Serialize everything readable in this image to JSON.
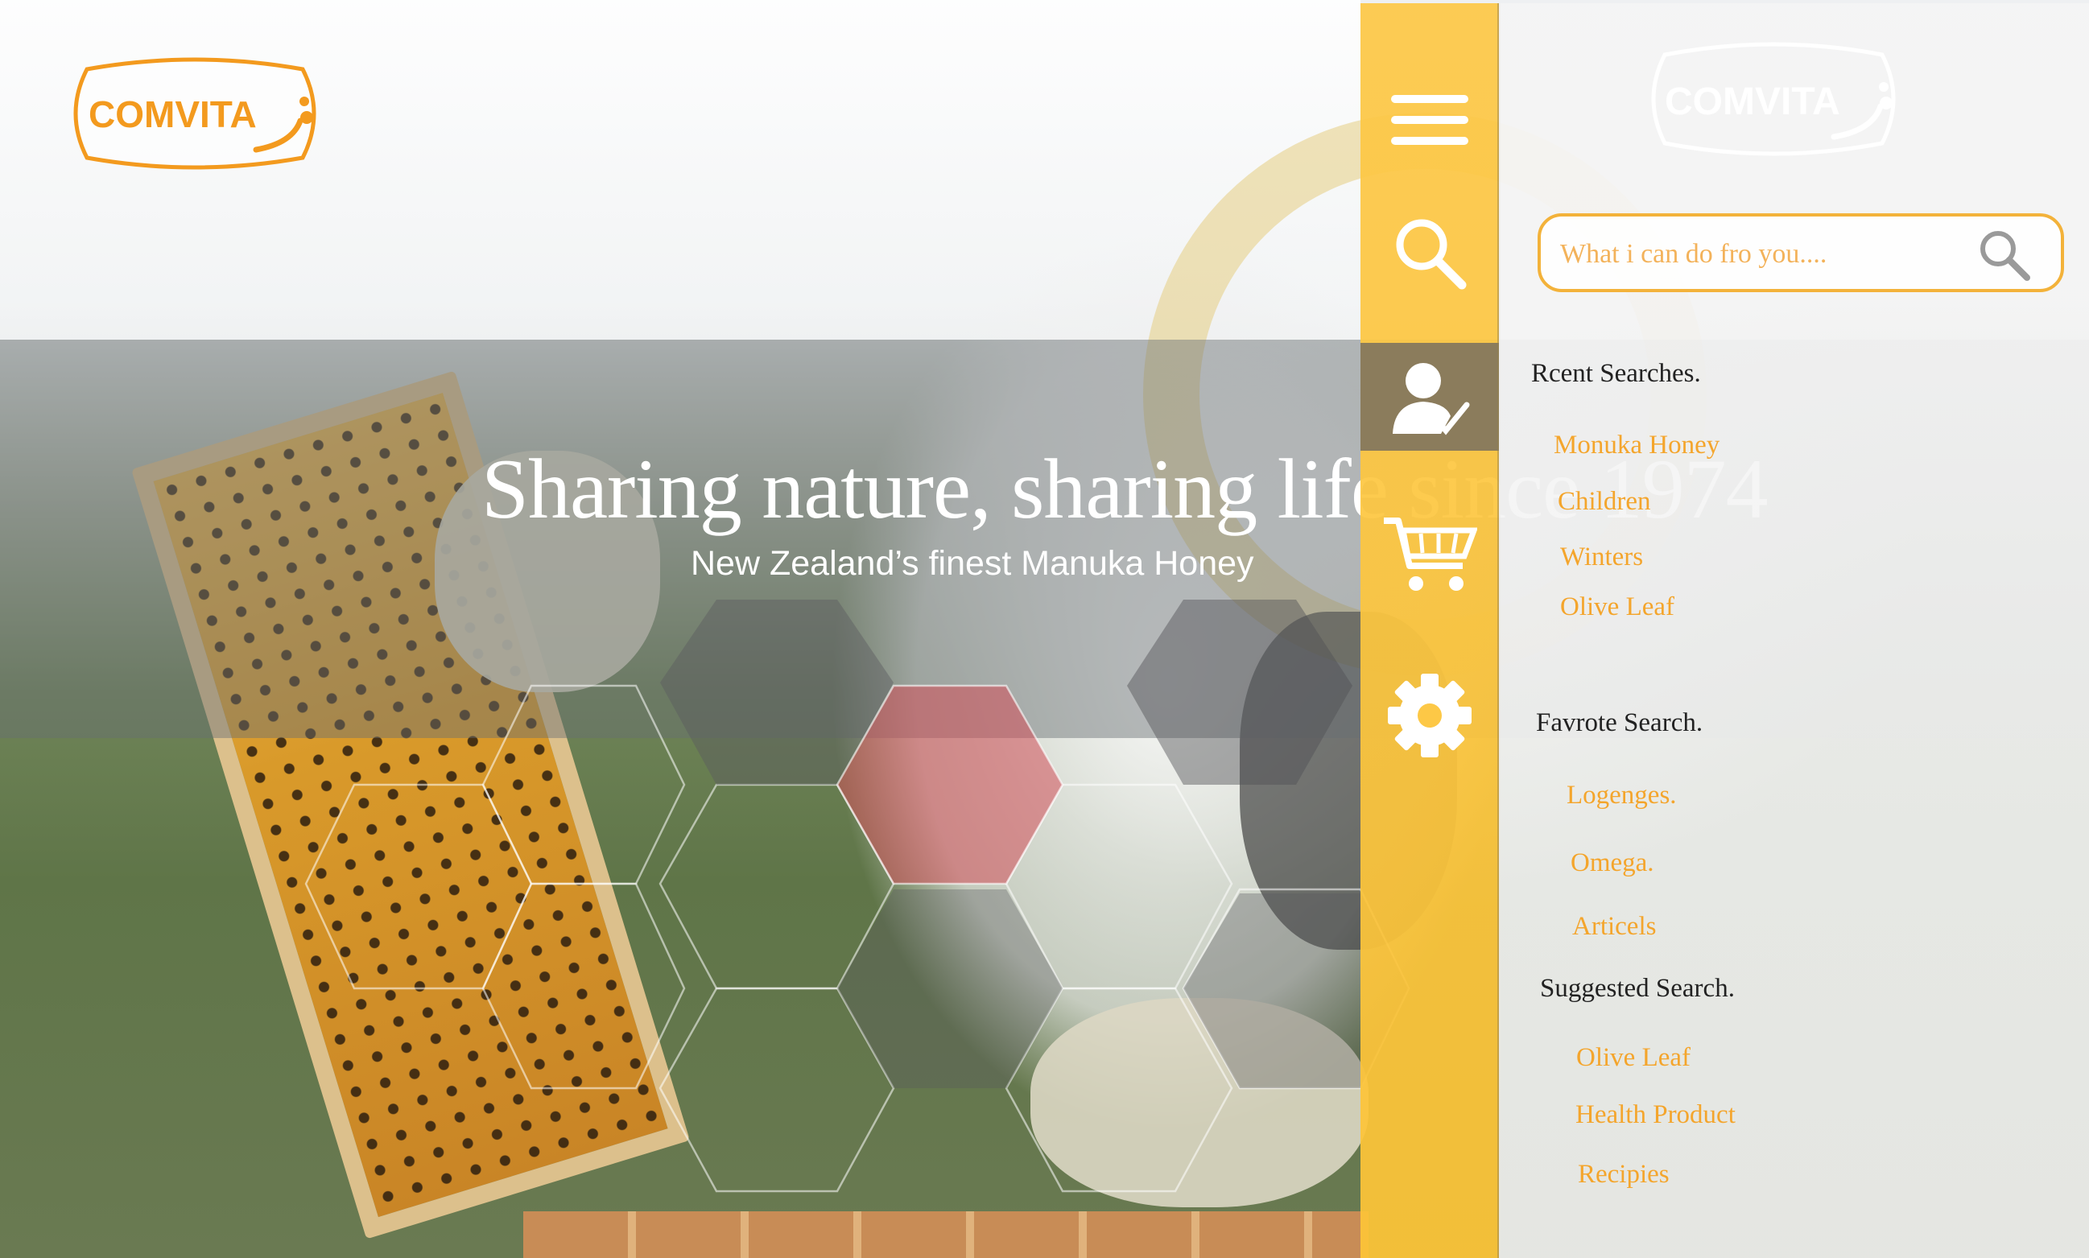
{
  "brand": {
    "logo_text": "COMVITA",
    "primary_color": "#f39a1e",
    "rail_color": "#fdc846"
  },
  "hero": {
    "title": "Sharing nature, sharing life since 1974",
    "subtitle": "New Zealand’s finest Manuka Honey"
  },
  "rail": {
    "items": [
      {
        "icon": "hamburger-menu-icon"
      },
      {
        "icon": "search-icon"
      },
      {
        "icon": "user-check-icon"
      },
      {
        "icon": "cart-icon"
      },
      {
        "icon": "gear-icon"
      }
    ]
  },
  "search": {
    "placeholder": "What i can do fro you....",
    "value": "",
    "button_icon": "search-icon"
  },
  "recent": {
    "heading": "Rcent Searches.",
    "items": [
      "Monuka Honey",
      "Children",
      "Winters",
      "Olive Leaf"
    ]
  },
  "favourite": {
    "heading": "Favrote Search.",
    "items": [
      "Logenges.",
      "Omega.",
      "Articels"
    ]
  },
  "suggested": {
    "heading": "Suggested Search.",
    "items": [
      "Olive Leaf",
      "Health Product",
      "Recipies"
    ]
  }
}
